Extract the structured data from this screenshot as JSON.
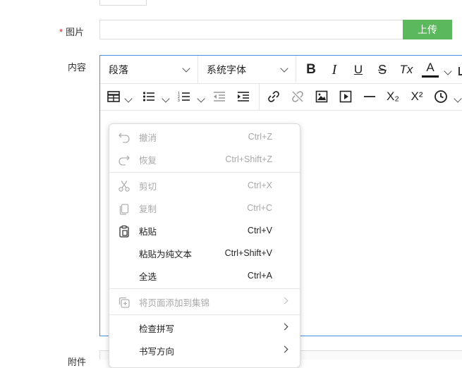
{
  "form": {
    "image_label": "图片",
    "required_mark": "*",
    "content_label": "内容",
    "attachment_label": "附件",
    "upload_label": "上传",
    "image_value": ""
  },
  "toolbar": {
    "paragraph_select": "段落",
    "font_select": "系统字体",
    "bold": "B",
    "italic": "I",
    "underline": "U",
    "strike": "S",
    "clear_format": "Tx",
    "font_color": "A",
    "subscript": "X₂",
    "superscript": "X²"
  },
  "colors": {
    "upload_button": "#5cb85c",
    "editor_border": "#4a90e2",
    "required": "#e02020",
    "disabled_text": "#a8a8a8"
  },
  "context_menu": {
    "items": [
      {
        "label": "撤消",
        "shortcut": "Ctrl+Z",
        "icon": "undo-icon",
        "enabled": false
      },
      {
        "label": "恢复",
        "shortcut": "Ctrl+Shift+Z",
        "icon": "redo-icon",
        "enabled": false
      },
      {
        "label": "剪切",
        "shortcut": "Ctrl+X",
        "icon": "cut-icon",
        "enabled": false
      },
      {
        "label": "复制",
        "shortcut": "Ctrl+C",
        "icon": "copy-icon",
        "enabled": false
      },
      {
        "label": "粘贴",
        "shortcut": "Ctrl+V",
        "icon": "paste-icon",
        "enabled": true
      },
      {
        "label": "粘贴为纯文本",
        "shortcut": "Ctrl+Shift+V",
        "icon": "",
        "enabled": true
      },
      {
        "label": "全选",
        "shortcut": "Ctrl+A",
        "icon": "",
        "enabled": true
      },
      {
        "label": "将页面添加到集锦",
        "shortcut": "",
        "icon": "collections-icon",
        "enabled": false,
        "submenu": true
      },
      {
        "label": "检查拼写",
        "shortcut": "",
        "icon": "",
        "enabled": true,
        "submenu": true
      },
      {
        "label": "书写方向",
        "shortcut": "",
        "icon": "",
        "enabled": true,
        "submenu": true
      }
    ]
  }
}
